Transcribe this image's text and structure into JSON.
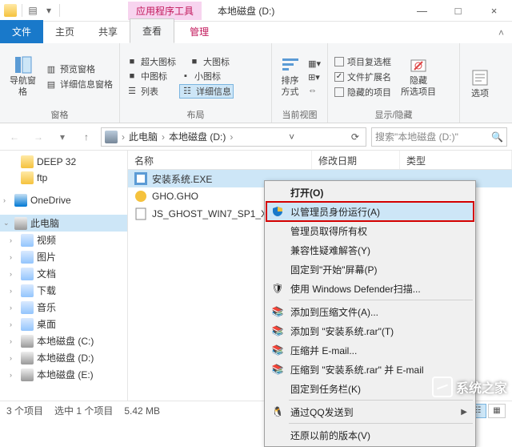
{
  "titlebar": {
    "context_tab": "应用程序工具",
    "title": "本地磁盘 (D:)",
    "min": "—",
    "max": "□",
    "close": "×"
  },
  "tabs": {
    "file": "文件",
    "home": "主页",
    "share": "共享",
    "view": "查看",
    "manage": "管理"
  },
  "ribbon": {
    "panes": {
      "nav_pane": "导航窗格",
      "preview_pane": "预览窗格",
      "details_pane": "详细信息窗格",
      "group": "窗格"
    },
    "layout": {
      "extra_large": "超大图标",
      "large": "大图标",
      "medium": "中图标",
      "small": "小图标",
      "list": "列表",
      "details": "详细信息",
      "group": "布局"
    },
    "current": {
      "sort": "排序方式",
      "group": "当前视图"
    },
    "showhide": {
      "checkboxes": "项目复选框",
      "extensions": "文件扩展名",
      "hidden_items": "隐藏的项目",
      "hide": "隐藏\n所选项目",
      "group": "显示/隐藏"
    },
    "options": {
      "label": "选项"
    }
  },
  "breadcrumb": {
    "this_pc": "此电脑",
    "drive": "本地磁盘 (D:)"
  },
  "search": {
    "placeholder": "搜索\"本地磁盘 (D:)\""
  },
  "tree": {
    "deep32": "DEEP 32",
    "ftp": "ftp",
    "onedrive": "OneDrive",
    "this_pc": "此电脑",
    "videos": "视频",
    "pictures": "图片",
    "documents": "文档",
    "downloads": "下载",
    "music": "音乐",
    "desktop": "桌面",
    "drive_c": "本地磁盘 (C:)",
    "drive_d": "本地磁盘 (D:)",
    "drive_e": "本地磁盘 (E:)"
  },
  "columns": {
    "name": "名称",
    "modified": "修改日期",
    "type": "类型"
  },
  "files": [
    {
      "name": "安装系统.EXE"
    },
    {
      "name": "GHO.GHO"
    },
    {
      "name": "JS_GHOST_WIN7_SP1_X86"
    }
  ],
  "context_menu": {
    "open": "打开(O)",
    "run_as_admin": "以管理员身份运行(A)",
    "admin_ownership": "管理员取得所有权",
    "troubleshoot": "兼容性疑难解答(Y)",
    "pin_start": "固定到\"开始\"屏幕(P)",
    "defender": "使用 Windows Defender扫描...",
    "add_archive": "添加到压缩文件(A)...",
    "add_rar": "添加到 \"安装系统.rar\"(T)",
    "compress_email": "压缩并 E-mail...",
    "compress_rar_email": "压缩到 \"安装系统.rar\" 并 E-mail",
    "pin_taskbar": "固定到任务栏(K)",
    "send_qq": "通过QQ发送到",
    "restore": "还原以前的版本(V)"
  },
  "status": {
    "count": "3 个项目",
    "selected": "选中 1 个项目",
    "size": "5.42 MB"
  },
  "watermark": "系统之家"
}
